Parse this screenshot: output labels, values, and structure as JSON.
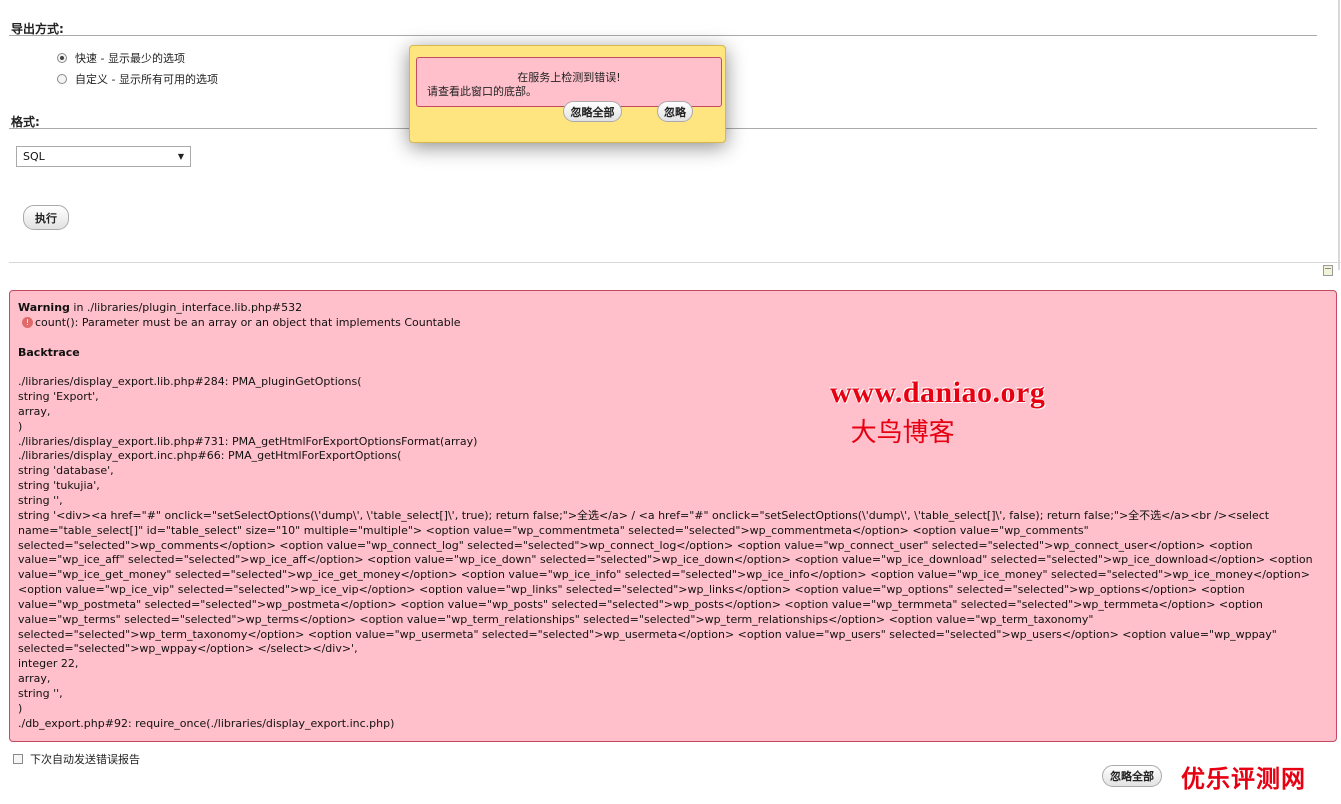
{
  "export": {
    "method_title": "导出方式:",
    "options": [
      {
        "label": "快速 - 显示最少的选项",
        "checked": true
      },
      {
        "label": "自定义 - 显示所有可用的选项",
        "checked": false
      }
    ],
    "format_title": "格式:",
    "format_value": "SQL",
    "execute_label": "执行"
  },
  "error": {
    "warning_label": "Warning",
    "warning_location": " in ./libraries/plugin_interface.lib.php#532",
    "message": "count(): Parameter must be an array or an object that implements Countable",
    "backtrace_title": "Backtrace",
    "trace_lines": [
      "./libraries/display_export.lib.php#284: PMA_pluginGetOptions(",
      "string 'Export',",
      "array,",
      ")",
      "./libraries/display_export.lib.php#731: PMA_getHtmlForExportOptionsFormat(array)",
      "./libraries/display_export.inc.php#66: PMA_getHtmlForExportOptions(",
      "string 'database',",
      "string 'tukujia',",
      "string '',",
      "string '<div><a href=\"#\" onclick=\"setSelectOptions(\\'dump\\', \\'table_select[]\\', true); return false;\">全选</a> / <a href=\"#\" onclick=\"setSelectOptions(\\'dump\\', \\'table_select[]\\', false); return false;\">全不选</a><br /><select name=\"table_select[]\" id=\"table_select\" size=\"10\" multiple=\"multiple\"> <option value=\"wp_commentmeta\" selected=\"selected\">wp_commentmeta</option> <option value=\"wp_comments\" selected=\"selected\">wp_comments</option> <option value=\"wp_connect_log\" selected=\"selected\">wp_connect_log</option> <option value=\"wp_connect_user\" selected=\"selected\">wp_connect_user</option> <option value=\"wp_ice_aff\" selected=\"selected\">wp_ice_aff</option> <option value=\"wp_ice_down\" selected=\"selected\">wp_ice_down</option> <option value=\"wp_ice_download\" selected=\"selected\">wp_ice_download</option> <option value=\"wp_ice_get_money\" selected=\"selected\">wp_ice_get_money</option> <option value=\"wp_ice_info\" selected=\"selected\">wp_ice_info</option> <option value=\"wp_ice_money\" selected=\"selected\">wp_ice_money</option> <option value=\"wp_ice_vip\" selected=\"selected\">wp_ice_vip</option> <option value=\"wp_links\" selected=\"selected\">wp_links</option> <option value=\"wp_options\" selected=\"selected\">wp_options</option> <option value=\"wp_postmeta\" selected=\"selected\">wp_postmeta</option> <option value=\"wp_posts\" selected=\"selected\">wp_posts</option> <option value=\"wp_termmeta\" selected=\"selected\">wp_termmeta</option> <option value=\"wp_terms\" selected=\"selected\">wp_terms</option> <option value=\"wp_term_relationships\" selected=\"selected\">wp_term_relationships</option> <option value=\"wp_term_taxonomy\" selected=\"selected\">wp_term_taxonomy</option> <option value=\"wp_usermeta\" selected=\"selected\">wp_usermeta</option> <option value=\"wp_users\" selected=\"selected\">wp_users</option> <option value=\"wp_wppay\" selected=\"selected\">wp_wppay</option> </select></div>',",
      "integer 22,",
      "array,",
      "string '',",
      ")",
      "./db_export.php#92: require_once(./libraries/display_export.inc.php)"
    ]
  },
  "watermark": {
    "url": "www.daniao.org",
    "name": "大鸟博客"
  },
  "footer": {
    "auto_report_label": "下次自动发送错误报告",
    "ignore_all_label": "忽略全部",
    "corner_mark": "优乐评测网"
  },
  "popup": {
    "line1": "在服务上检测到错误!",
    "line2": "请查看此窗口的底部。",
    "ignore_all_label": "忽略全部",
    "ignore_label": "忽略"
  },
  "colors": {
    "error_bg": "#ffc0cb",
    "popup_bg": "#ffe57f",
    "watermark": "#e60012"
  },
  "icons": [
    "warning-icon",
    "page-icon",
    "dropdown-arrow-icon"
  ]
}
